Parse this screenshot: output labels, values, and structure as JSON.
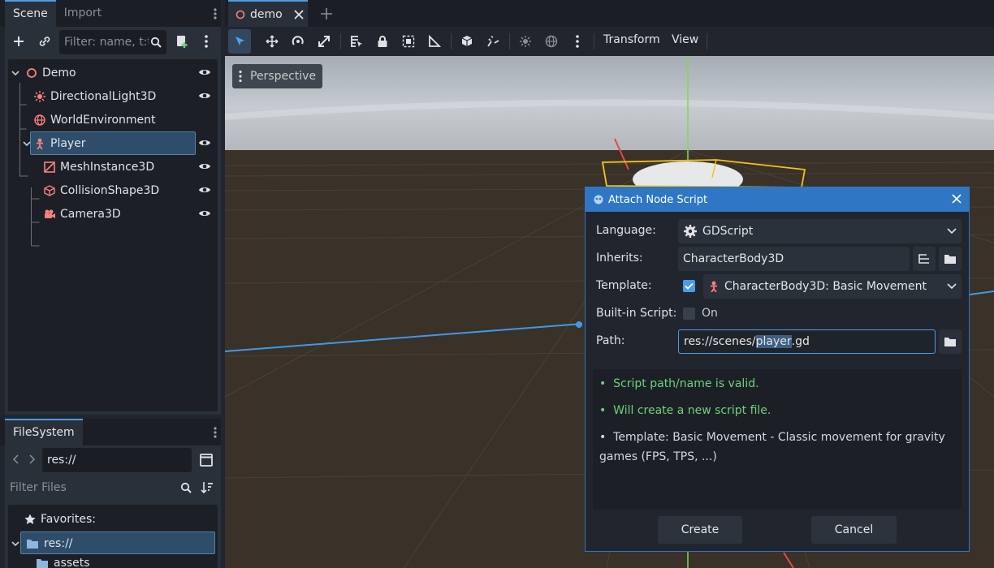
{
  "scene_dock": {
    "tabs": [
      "Scene",
      "Import"
    ],
    "filter_placeholder": "Filter: name, t:t",
    "tree": [
      {
        "label": "Demo",
        "visible_toggle": true
      },
      {
        "label": "DirectionalLight3D",
        "visible_toggle": true
      },
      {
        "label": "WorldEnvironment",
        "visible_toggle": false
      },
      {
        "label": "Player",
        "visible_toggle": true,
        "selected": true
      },
      {
        "label": "MeshInstance3D",
        "visible_toggle": true
      },
      {
        "label": "CollisionShape3D",
        "visible_toggle": true
      },
      {
        "label": "Camera3D",
        "visible_toggle": true
      }
    ]
  },
  "filesystem_dock": {
    "tab": "FileSystem",
    "path": "res://",
    "filter_placeholder": "Filter Files",
    "favorites_label": "Favorites:",
    "root_label": "res://",
    "child_label": "assets"
  },
  "editor": {
    "scene_tab": "demo",
    "toolbar_menus": [
      "Transform",
      "View"
    ],
    "viewport_label": "Perspective"
  },
  "dialog": {
    "title": "Attach Node Script",
    "language_label": "Language:",
    "language_value": "GDScript",
    "inherits_label": "Inherits:",
    "inherits_value": "CharacterBody3D",
    "template_label": "Template:",
    "template_checked": true,
    "template_value": "CharacterBody3D: Basic Movement",
    "builtin_label": "Built-in Script:",
    "builtin_value": "On",
    "builtin_checked": false,
    "path_label": "Path:",
    "path_prefix": "res://scenes/",
    "path_selected": "player",
    "path_suffix": ".gd",
    "messages": [
      {
        "text": "Script path/name is valid.",
        "color": "#6fd17a"
      },
      {
        "text": "Will create a new script file.",
        "color": "#6fd17a"
      },
      {
        "text": "Template: Basic Movement - Classic movement for gravity games (FPS, TPS, ...)",
        "color": "#d4d7db"
      }
    ],
    "create_label": "Create",
    "cancel_label": "Cancel"
  },
  "colors": {
    "accent": "#2f77c4",
    "selection": "#2d4d6b",
    "node_red": "#fc7f7f",
    "valid_green": "#6fd17a"
  }
}
